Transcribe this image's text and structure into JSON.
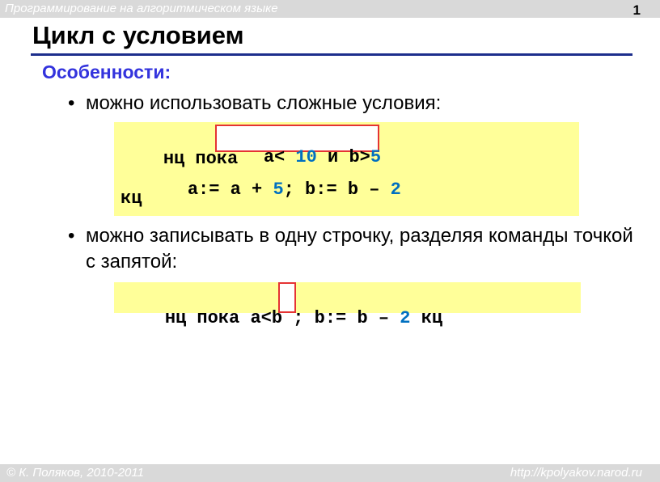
{
  "header": {
    "course": "Программирование на алгоритмическом языке",
    "page_number": "1"
  },
  "title": "Цикл с условием",
  "subtitle": "Особенности:",
  "bullets": [
    {
      "marker": "•",
      "text": "можно использовать сложные условия:"
    },
    {
      "marker": "•",
      "text": "можно записывать в одну строчку, разделяя команды точкой с запятой:"
    }
  ],
  "code_block_1": {
    "line1_keyword": "нц пока",
    "condition": {
      "a": "a",
      "lt": "<",
      "ten": "10",
      "and": "и",
      "b": "b",
      "gt": ">",
      "five": "5"
    },
    "line2": {
      "a": "a",
      "assign1": ":=",
      "a2": "a",
      "plus": "+",
      "five": "5",
      "semi": ";",
      "b": "b",
      "assign2": ":=",
      "b2": "b",
      "minus": "–",
      "two": "2"
    },
    "line3": "кц"
  },
  "code_block_2": {
    "keyword": "нц пока",
    "a": "a",
    "lt": "<",
    "b": "b",
    "semi": ";",
    "b2": "b",
    "assign": ":=",
    "b3": "b",
    "minus": "–",
    "two": "2",
    "end": "кц"
  },
  "footer": {
    "author": "© К. Поляков, 2010-2011",
    "url": "http://kpolyakov.narod.ru"
  },
  "colors": {
    "accent_blue": "#3333dd",
    "rule_navy": "#1c2e8c",
    "number_blue": "#0070c0",
    "code_bg": "#ffff99",
    "highlight_red": "#e53333",
    "bar_gray": "#d9d9d9"
  }
}
